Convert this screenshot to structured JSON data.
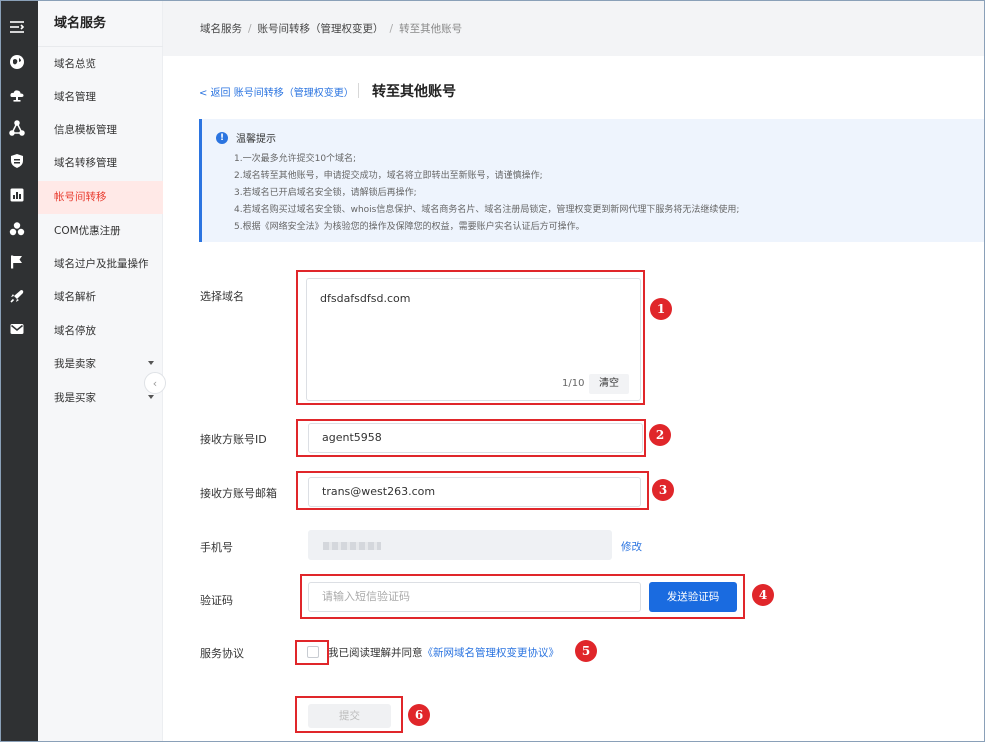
{
  "sidebar": {
    "title": "域名服务",
    "items": [
      {
        "label": "域名总览"
      },
      {
        "label": "域名管理"
      },
      {
        "label": "信息模板管理"
      },
      {
        "label": "域名转移管理"
      },
      {
        "label": "帐号间转移"
      },
      {
        "label": "COM优惠注册"
      },
      {
        "label": "域名过户及批量操作"
      },
      {
        "label": "域名解析"
      },
      {
        "label": "域名停放"
      },
      {
        "label": "我是卖家"
      },
      {
        "label": "我是买家"
      }
    ],
    "active_item": "帐号间转移",
    "collapse_glyph": "‹"
  },
  "rail_icons": [
    "menu-toggle-icon",
    "globe-icon",
    "cloud-icon",
    "network-icon",
    "shield-icon",
    "chart-icon",
    "cluster-icon",
    "flag-icon",
    "rocket-icon",
    "mail-icon"
  ],
  "breadcrumb": [
    "域名服务",
    "账号间转移（管理权变更）",
    "转至其他账号"
  ],
  "breadcrumb_sep": "/",
  "header": {
    "back_link": "< 返回 账号间转移（管理权变更）",
    "title": "转至其他账号"
  },
  "tips": {
    "icon_glyph": "!",
    "title": "温馨提示",
    "lines": [
      "1.一次最多允许提交10个域名;",
      "2.域名转至其他账号，申请提交成功，域名将立即转出至新账号，请谨慎操作;",
      "3.若域名已开启域名安全锁，请解锁后再操作;",
      "4.若域名购买过域名安全锁、whois信息保护、域名商务名片、域名注册局锁定，管理权变更到新网代理下服务将无法继续使用;",
      "5.根据《网络安全法》为核验您的操作及保障您的权益，需要账户实名认证后方可操作。"
    ]
  },
  "form": {
    "domain": {
      "label": "选择域名",
      "value": "dfsdafsdfsd.com",
      "count": "1/10",
      "clear_label": "清空"
    },
    "account_id": {
      "label": "接收方账号ID",
      "value": "agent5958"
    },
    "account_email": {
      "label": "接收方账号邮箱",
      "value": "trans@west263.com"
    },
    "phone": {
      "label": "手机号",
      "edit_label": "修改"
    },
    "verify_code": {
      "label": "验证码",
      "placeholder": "请输入短信验证码",
      "send_label": "发送验证码"
    },
    "agreement": {
      "label": "服务协议",
      "text": "我已阅读理解并同意",
      "link": "《新网域名管理权变更协议》"
    },
    "submit_label": "提交"
  },
  "markers": [
    "1",
    "2",
    "3",
    "4",
    "5",
    "6"
  ],
  "colors": {
    "accent": "#2b74e0",
    "annotation": "#e0262a",
    "active_menu_bg": "#ffe9e7",
    "active_menu_text": "#e83b2e",
    "rail": "#2f3133"
  }
}
